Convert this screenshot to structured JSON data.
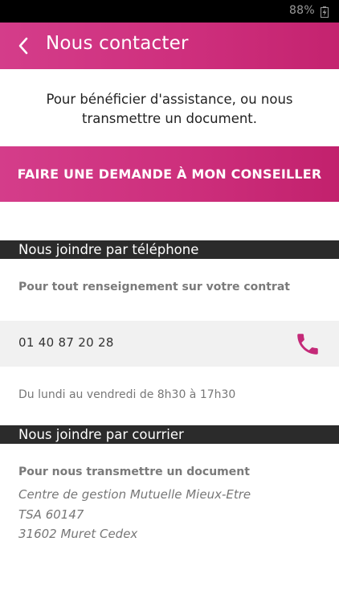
{
  "status_bar": {
    "battery_text": "88%"
  },
  "header": {
    "title": "Nous contacter"
  },
  "intro": {
    "text": "Pour bénéficier d'assistance, ou nous transmettre un document."
  },
  "cta": {
    "label": "FAIRE UNE DEMANDE À MON CONSEILLER"
  },
  "phone_section": {
    "title": "Nous joindre par téléphone",
    "subtitle": "Pour tout renseignement sur votre contrat",
    "number": "01 40 87 20 28",
    "hours": "Du lundi au vendredi de 8h30 à 17h30"
  },
  "mail_section": {
    "title": "Nous joindre par courrier",
    "subtitle": "Pour nous transmettre un document",
    "address_lines": [
      "Centre de gestion Mutuelle Mieux-Etre",
      "TSA 60147",
      "31602 Muret Cedex"
    ]
  },
  "colors": {
    "brand_pink": "#ce2f7d",
    "section_header_bg": "#2b2b2b",
    "phone_row_bg": "#f1f1f1"
  },
  "icons": {
    "back": "chevron-left-icon",
    "phone": "phone-icon",
    "battery": "battery-charging-icon"
  }
}
